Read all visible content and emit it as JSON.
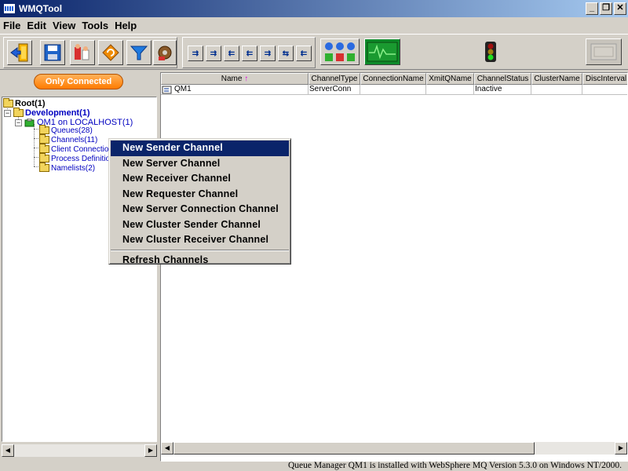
{
  "window": {
    "title": "WMQTool"
  },
  "menubar": {
    "items": [
      "File",
      "Edit",
      "View",
      "Tools",
      "Help"
    ]
  },
  "toolbar": {
    "main_buttons": [
      "exit-icon",
      "save-icon",
      "users-icon",
      "refresh-icon",
      "filter-icon",
      "settings-icon"
    ],
    "channel_buttons": [
      "sender-channel-icon",
      "server-channel-icon",
      "receiver-channel-icon",
      "requester-channel-icon",
      "cluster-sender-icon",
      "cluster-receiver-icon",
      "svrconn-channel-icon"
    ],
    "traffic_light": "traffic-light-icon",
    "monitor": "monitor-icon"
  },
  "left": {
    "filter_button": "Only Connected",
    "tree": {
      "root": "Root(1)",
      "development": "Development(1)",
      "qm": "QM1 on LOCALHOST(1)",
      "children": [
        "Queues(28)",
        "Channels(11)",
        "Client Connection",
        "Process Definitio",
        "Namelists(2)"
      ]
    }
  },
  "table": {
    "columns": [
      "Name",
      "ChannelType",
      "ConnectionName",
      "XmitQName",
      "ChannelStatus",
      "ClusterName",
      "DiscInterval"
    ],
    "sort_indicator": "↑",
    "rows": [
      [
        "QM1",
        "ServerConn",
        "",
        "",
        "Inactive",
        "",
        ""
      ]
    ]
  },
  "context_menu": {
    "items": [
      "New Sender Channel",
      "New Server Channel",
      "New Receiver Channel",
      "New Requester Channel",
      "New Server Connection Channel",
      "New Cluster Sender Channel",
      "New Cluster Receiver Channel"
    ],
    "refresh": "Refresh Channels",
    "selected_index": 0
  },
  "status": {
    "text": "Queue Manager QM1 is installed with WebSphere MQ Version 5.3.0 on Windows NT/2000."
  },
  "colors": {
    "title_bar": "#0a246a",
    "menu_highlight": "#0a246a",
    "tree_link": "#0000c0",
    "connected_button": "#ff8a1a",
    "sort_arrow": "#e000e0"
  }
}
